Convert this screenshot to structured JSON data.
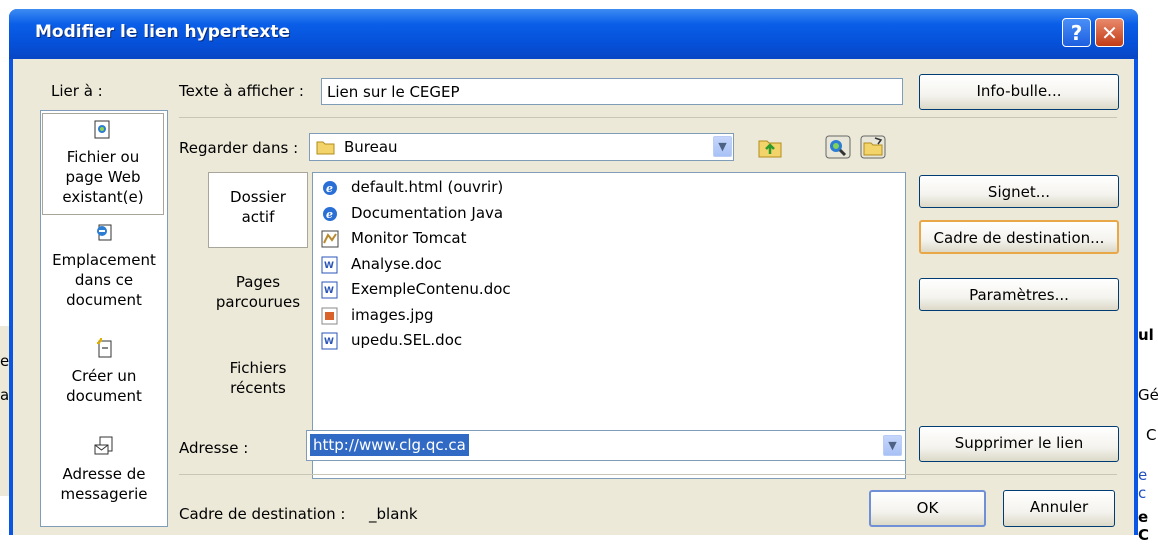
{
  "background": {
    "fragments": [
      "e",
      "a",
      "ul",
      "Gér",
      "C",
      "e c",
      "e C"
    ]
  },
  "dialog": {
    "title": "Modifier le lien hypertexte",
    "help_glyph": "?",
    "close_glyph": "✕"
  },
  "link_to": {
    "label": "Lier à :",
    "items": [
      {
        "line1": "Fichier ou",
        "line2": "page Web",
        "line3": "existant(e)",
        "icon": "existing-file-icon",
        "selected": true
      },
      {
        "line1": "Emplacement",
        "line2": "dans ce",
        "line3": "document",
        "icon": "place-in-document-icon",
        "selected": false
      },
      {
        "line1": "Créer un",
        "line2": "document",
        "icon": "new-document-icon",
        "selected": false
      },
      {
        "line1": "Adresse de",
        "line2": "messagerie",
        "icon": "email-address-icon",
        "selected": false
      }
    ]
  },
  "display_text": {
    "label": "Texte à afficher :",
    "value": "Lien sur le CEGEP"
  },
  "buttons": {
    "screentip": "Info-bulle...",
    "bookmark": "Signet...",
    "target_frame": "Cadre de destination...",
    "parameters": "Paramètres...",
    "remove_link": "Supprimer le lien",
    "ok": "OK",
    "cancel": "Annuler"
  },
  "look_in": {
    "label": "Regarder dans :",
    "value": "Bureau",
    "folder_icon": "folder-icon",
    "up_icon": "up-one-folder-icon",
    "browse_web_icon": "browse-web-icon",
    "browse_file_icon": "browse-file-icon"
  },
  "tabs": [
    {
      "line1": "Dossier",
      "line2": "actif",
      "selected": true
    },
    {
      "line1": "Pages",
      "line2": "parcourues",
      "selected": false
    },
    {
      "line1": "Fichiers",
      "line2": "récents",
      "selected": false
    }
  ],
  "files": [
    {
      "name": "default.html (ouvrir)",
      "icon": "ie-html-icon",
      "color": "#2a6fd6"
    },
    {
      "name": "Documentation Java",
      "icon": "ie-shortcut-icon",
      "color": "#2a6fd6"
    },
    {
      "name": "Monitor Tomcat",
      "icon": "tomcat-shortcut-icon",
      "color": "#b8892e"
    },
    {
      "name": "Analyse.doc",
      "icon": "word-doc-icon",
      "color": "#2b56b8"
    },
    {
      "name": "ExempleContenu.doc",
      "icon": "word-doc-icon",
      "color": "#2b56b8"
    },
    {
      "name": "images.jpg",
      "icon": "image-file-icon",
      "color": "#d9622b"
    },
    {
      "name": "upedu.SEL.doc",
      "icon": "word-doc-icon",
      "color": "#2b56b8"
    }
  ],
  "address": {
    "label": "Adresse :",
    "value": "http://www.clg.qc.ca"
  },
  "frame": {
    "label": "Cadre de destination :",
    "value": "_blank"
  },
  "colors": {
    "title_bar": "#0a5ee8",
    "dialog_face": "#ece9d8",
    "selection": "#316ac5"
  }
}
